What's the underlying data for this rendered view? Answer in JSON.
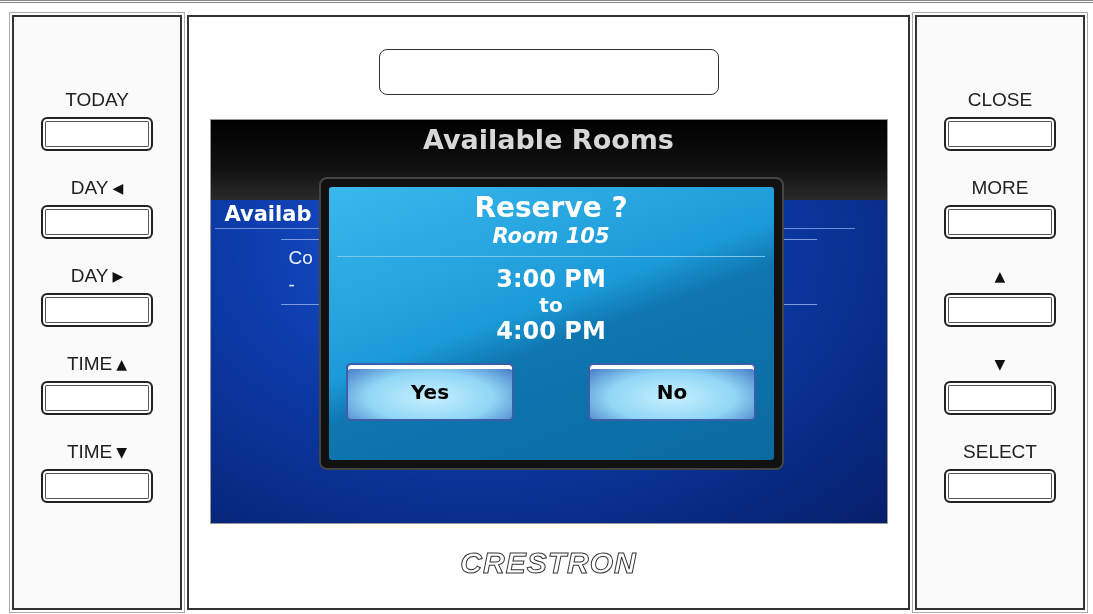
{
  "left_buttons": [
    {
      "label": "TODAY"
    },
    {
      "label": "DAY",
      "icon": "◀"
    },
    {
      "label": "DAY",
      "icon": "▶"
    },
    {
      "label": "TIME",
      "icon": "▲"
    },
    {
      "label": "TIME",
      "icon": "▼"
    }
  ],
  "right_buttons": [
    {
      "label": "CLOSE"
    },
    {
      "label": "MORE"
    },
    {
      "icon": "▲"
    },
    {
      "icon": "▼"
    },
    {
      "label": "SELECT"
    }
  ],
  "screen": {
    "title": "Available Rooms",
    "section_heading": "Availab",
    "row_lines": [
      "Co",
      "-"
    ]
  },
  "dialog": {
    "title": "Reserve ?",
    "room": "Room 105",
    "start": "3:00 PM",
    "separator": "to",
    "end": "4:00 PM",
    "buttons": [
      "Yes",
      "No"
    ]
  },
  "logo": "CRESTRON"
}
